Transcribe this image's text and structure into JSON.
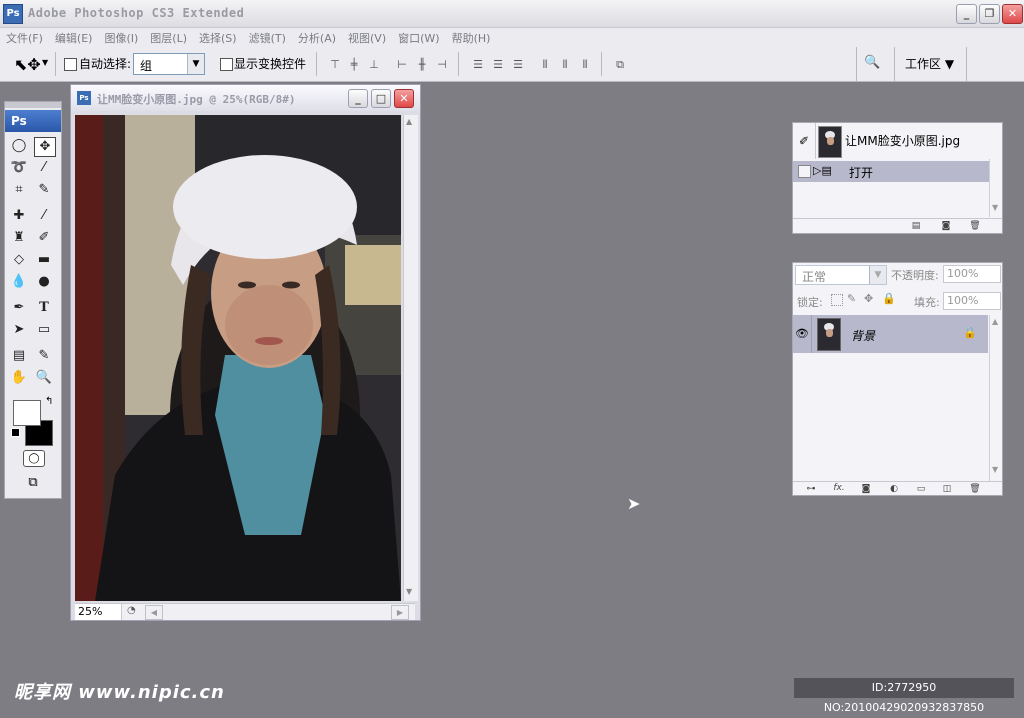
{
  "app": {
    "title": "Adobe Photoshop CS3 Extended",
    "logo": "Ps"
  },
  "window_controls": {
    "minimize": "_",
    "restore": "❐",
    "close": "✕"
  },
  "menu": [
    "文件(F)",
    "编辑(E)",
    "图像(I)",
    "图层(L)",
    "选择(S)",
    "滤镜(T)",
    "分析(A)",
    "视图(V)",
    "窗口(W)",
    "帮助(H)"
  ],
  "options_bar": {
    "auto_select_label": "自动选择:",
    "auto_select_value": "组",
    "show_transform_label": "显示变换控件",
    "workspace_label": "工作区 ▼"
  },
  "toolbox": {
    "header": "Ps"
  },
  "document": {
    "title": "让MM脸变小原图.jpg @ 25%(RGB/8#)",
    "zoom": "25%"
  },
  "history_panel": {
    "snapshot_name": "让MM脸变小原图.jpg",
    "step": "打开"
  },
  "layers_panel": {
    "blend_mode": "正常",
    "opacity_label": "不透明度:",
    "opacity_value": "100%",
    "lock_label": "锁定:",
    "fill_label": "填充:",
    "fill_value": "100%",
    "layer_name": "背景"
  },
  "watermark": {
    "site": "昵享网 www.nipic.cn",
    "id": "ID:2772950 NO:20100429020932837850"
  },
  "colors": {
    "workspace_bg": "#7f7d84",
    "toolbox_header": "#2a56a8",
    "layer_selected": "#b8b8cc"
  }
}
